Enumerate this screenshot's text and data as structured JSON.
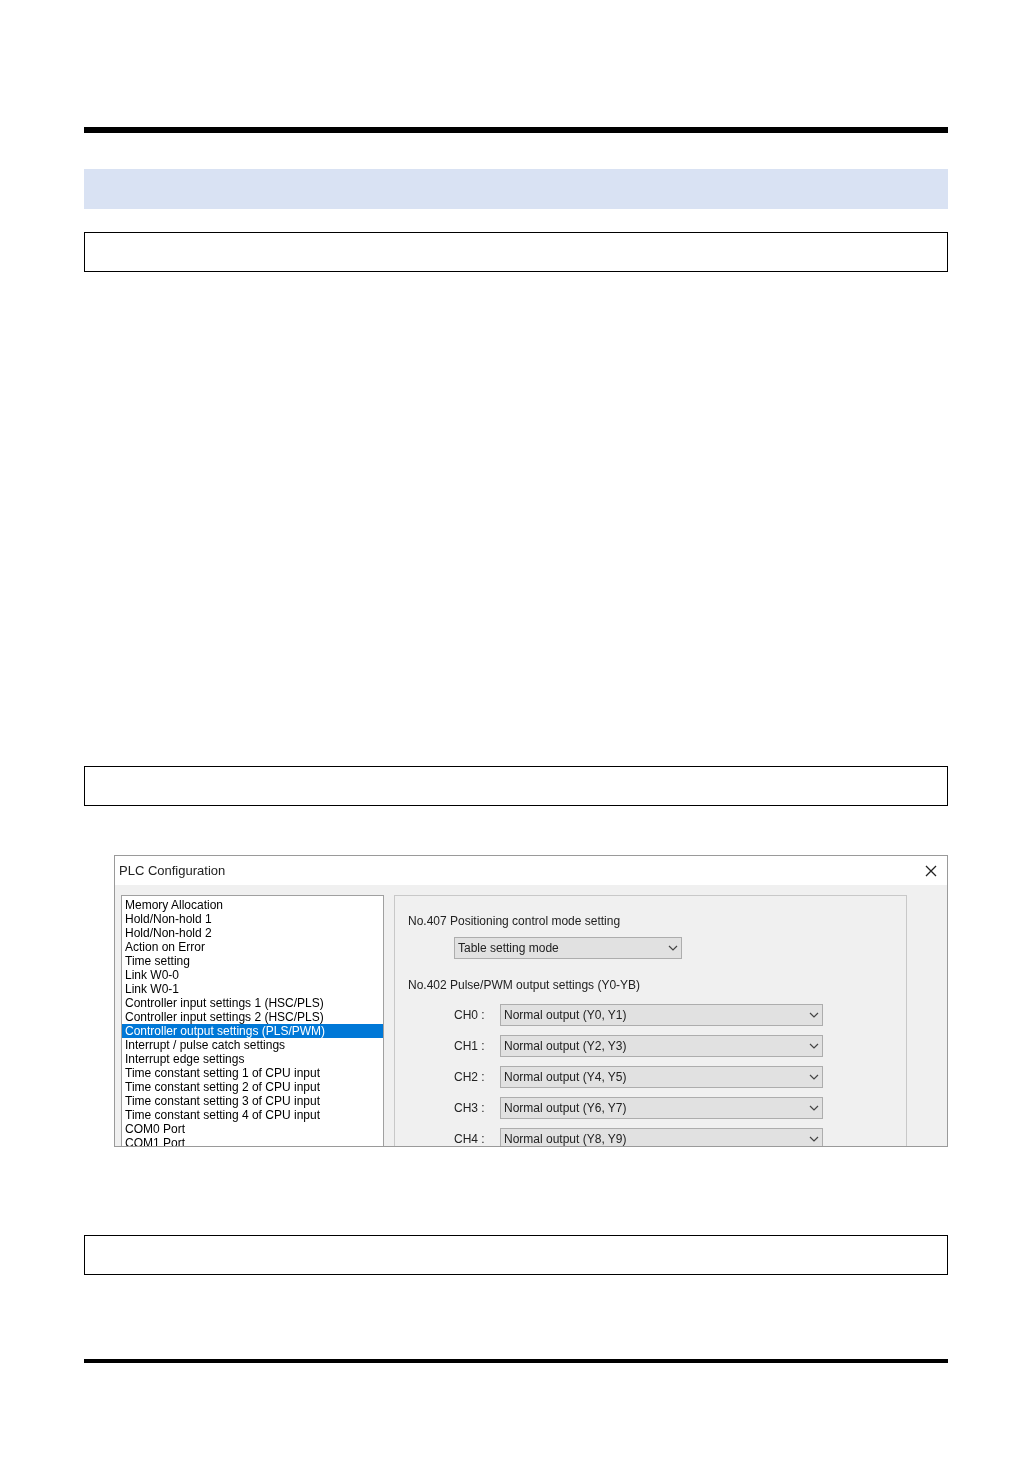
{
  "dialog": {
    "title": "PLC Configuration",
    "categories": [
      {
        "label": "Memory Allocation",
        "selected": false
      },
      {
        "label": "Hold/Non-hold 1",
        "selected": false
      },
      {
        "label": "Hold/Non-hold 2",
        "selected": false
      },
      {
        "label": "Action on Error",
        "selected": false
      },
      {
        "label": "Time setting",
        "selected": false
      },
      {
        "label": "Link W0-0",
        "selected": false
      },
      {
        "label": "Link W0-1",
        "selected": false
      },
      {
        "label": "Controller input settings 1 (HSC/PLS)",
        "selected": false
      },
      {
        "label": "Controller input settings 2 (HSC/PLS)",
        "selected": false
      },
      {
        "label": "Controller output settings (PLS/PWM)",
        "selected": true
      },
      {
        "label": "Interrupt / pulse catch settings",
        "selected": false
      },
      {
        "label": "Interrupt edge settings",
        "selected": false
      },
      {
        "label": "Time constant setting 1 of CPU input",
        "selected": false
      },
      {
        "label": "Time constant setting 2 of CPU input",
        "selected": false
      },
      {
        "label": "Time constant setting 3 of CPU input",
        "selected": false
      },
      {
        "label": "Time constant setting 4 of CPU input",
        "selected": false
      },
      {
        "label": "COM0 Port",
        "selected": false
      },
      {
        "label": "COM1 Port",
        "selected": false
      }
    ],
    "positioning": {
      "label": "No.407 Positioning control mode setting",
      "value": "Table setting mode"
    },
    "pulse_output": {
      "label": "No.402 Pulse/PWM output settings (Y0-YB)",
      "channels": [
        {
          "label": "CH0 :",
          "value": "Normal output (Y0, Y1)"
        },
        {
          "label": "CH1 :",
          "value": "Normal output (Y2, Y3)"
        },
        {
          "label": "CH2 :",
          "value": "Normal output (Y4, Y5)"
        },
        {
          "label": "CH3 :",
          "value": "Normal output (Y6, Y7)"
        },
        {
          "label": "CH4 :",
          "value": "Normal output (Y8, Y9)"
        }
      ]
    }
  }
}
